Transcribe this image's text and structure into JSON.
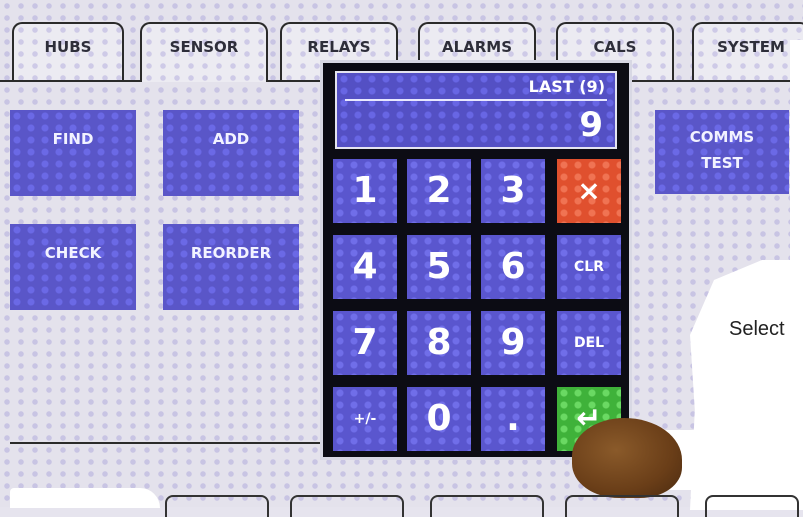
{
  "tabs": [
    "HUBS",
    "SENSOR",
    "RELAYS",
    "ALARMS",
    "CALS",
    "SYSTEM"
  ],
  "active_tab": "SENSOR",
  "sensor_buttons": {
    "find": "FIND",
    "add": "ADD",
    "check": "CHECK",
    "reorder": "REORDER",
    "comms_test_line1": "COMMS",
    "comms_test_line2": "TEST"
  },
  "keypad": {
    "last_label": "LAST (9)",
    "value": "9",
    "keys": {
      "k1": "1",
      "k2": "2",
      "k3": "3",
      "cancel": "×",
      "k4": "4",
      "k5": "5",
      "k6": "6",
      "clr": "CLR",
      "k7": "7",
      "k8": "8",
      "k9": "9",
      "del": "DEL",
      "plusminus": "+/-",
      "k0": "0",
      "dot": ".",
      "enter": "↵"
    }
  },
  "caption": "Select",
  "colors": {
    "button_blue": "#5a56ce",
    "cancel_red": "#e0502e",
    "enter_green": "#3fb23a",
    "keypad_bg": "#0c0c14"
  }
}
